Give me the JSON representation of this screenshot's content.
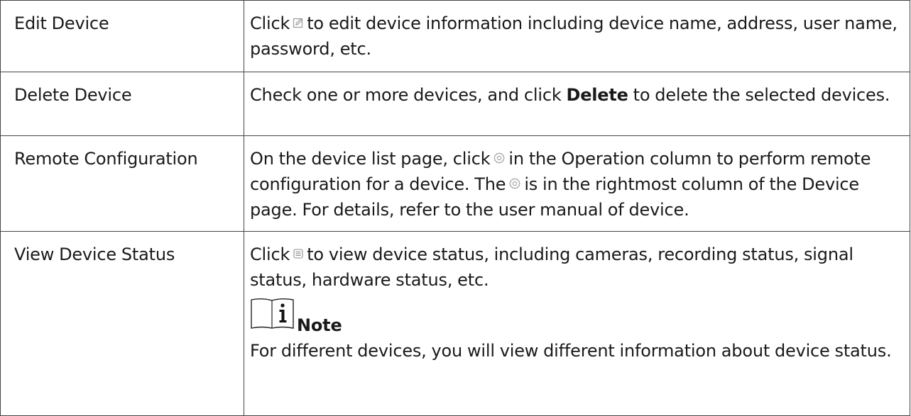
{
  "rows": [
    {
      "label": "Edit Device",
      "text_before": "Click",
      "icon": "edit-icon",
      "text_after": "to edit device information including device name, address, user name, password, etc."
    },
    {
      "label": "Delete Device",
      "text_before": "Check one or more devices, and click",
      "bold": "Delete",
      "text_after": "to delete the selected devices."
    },
    {
      "label": "Remote Configuration",
      "text_1": "On the device list page, click",
      "icon_1": "settings-icon",
      "text_2": "in the Operation column to perform remote configuration for a device. The",
      "icon_2": "settings-icon",
      "text_3": "is in the rightmost column of the Device page. For details, refer to the user manual of device."
    },
    {
      "label": "View Device Status",
      "text_before": "Click",
      "icon": "device-status-icon",
      "text_after": "to view device status, including cameras, recording status, signal status, hardware status, etc.",
      "note": {
        "icon": "info-icon",
        "title": "Note",
        "text": "For different devices, you will view different information about device status."
      }
    }
  ]
}
